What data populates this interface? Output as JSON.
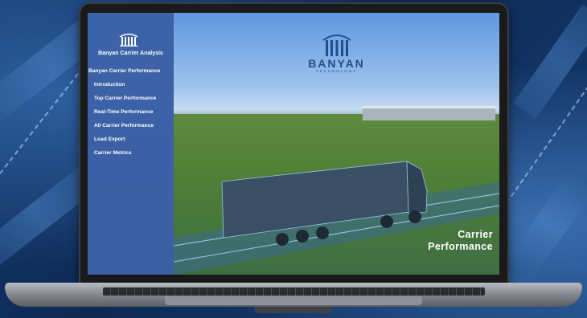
{
  "sidebar": {
    "app_title": "Banyan Carrier Analysis",
    "section_header": "Banyan Carrier Performance",
    "items": [
      {
        "label": "Introduction"
      },
      {
        "label": "Top Carrier Performance"
      },
      {
        "label": "Real-Time Performance"
      },
      {
        "label": "All Carrier Performance"
      },
      {
        "label": "Load Export"
      },
      {
        "label": "Carrier Metrics"
      }
    ]
  },
  "hero": {
    "brand_name": "BANYAN",
    "brand_sub": "TECHNOLOGY",
    "title_line1": "Carrier",
    "title_line2": "Performance"
  },
  "colors": {
    "sidebar": "#3c62a8",
    "brand_blue": "#1f4f8d",
    "background": "#0d2a55"
  },
  "icons": [
    "banyan-logo-icon",
    "banyan-brand-icon"
  ]
}
